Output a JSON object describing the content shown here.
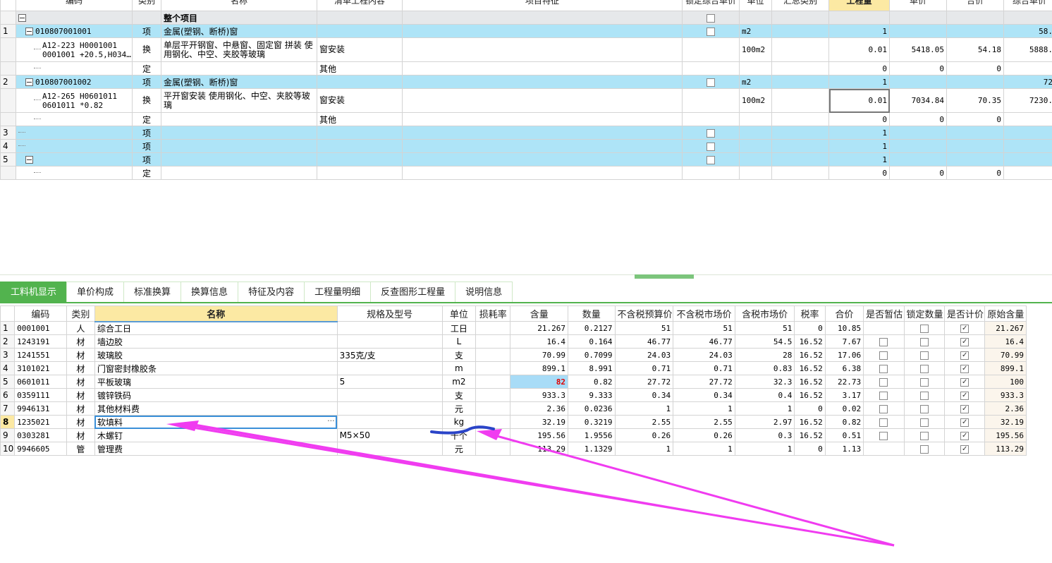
{
  "top_headers": [
    "编码",
    "类别",
    "名称",
    "清单工程内容",
    "项目特征",
    "锁定综合单价",
    "单位",
    "汇总类别",
    "工程量",
    "单价",
    "合价",
    "综合单价"
  ],
  "top_rows": [
    {
      "no": "",
      "code": "",
      "cat": "",
      "name": "整个项目",
      "content": "",
      "feature": "",
      "lock": true,
      "unit": "",
      "sum": "",
      "qty": "",
      "price": "",
      "total": "",
      "comp": "",
      "style": "root"
    },
    {
      "no": "1",
      "code": "010807001001",
      "cat": "项",
      "name": "金属(塑钢、断桥)窗",
      "content": "",
      "feature": "",
      "lock": true,
      "unit": "m2",
      "sum": "",
      "qty": "1",
      "price": "",
      "total": "",
      "comp": "58.",
      "style": "blue"
    },
    {
      "no": "",
      "code": "A12-223 H0001001 0001001 +20.5,H034…",
      "cat": "换",
      "name": "单层平开钢窗、中悬窗、固定窗  拼装  使用钢化、中空、夹胶等玻璃",
      "content": "窗安装",
      "feature": "",
      "lock": false,
      "unit": "100m2",
      "sum": "",
      "qty": "0.01",
      "price": "5418.05",
      "total": "54.18",
      "comp": "5888.",
      "style": "white"
    },
    {
      "no": "",
      "code": "",
      "cat": "定",
      "name": "",
      "content": "其他",
      "feature": "",
      "lock": false,
      "unit": "",
      "sum": "",
      "qty": "0",
      "price": "0",
      "total": "0",
      "comp": "",
      "style": "white"
    },
    {
      "no": "2",
      "code": "010807001002",
      "cat": "项",
      "name": "金属(塑钢、断桥)窗",
      "content": "",
      "feature": "",
      "lock": true,
      "unit": "m2",
      "sum": "",
      "qty": "1",
      "price": "",
      "total": "",
      "comp": "72",
      "style": "blue"
    },
    {
      "no": "",
      "code": "A12-265 H0601011 0601011 *0.82",
      "cat": "换",
      "name": "平开窗安装  使用钢化、中空、夹胶等玻璃",
      "content": "窗安装",
      "feature": "",
      "lock": false,
      "unit": "100m2",
      "sum": "",
      "qty": "0.01",
      "price": "7034.84",
      "total": "70.35",
      "comp": "7230.",
      "style": "white"
    },
    {
      "no": "",
      "code": "",
      "cat": "定",
      "name": "",
      "content": "其他",
      "feature": "",
      "lock": false,
      "unit": "",
      "sum": "",
      "qty": "0",
      "price": "0",
      "total": "0",
      "comp": "",
      "style": "white"
    },
    {
      "no": "3",
      "code": "",
      "cat": "项",
      "name": "",
      "content": "",
      "feature": "",
      "lock": true,
      "unit": "",
      "sum": "",
      "qty": "1",
      "price": "",
      "total": "",
      "comp": "",
      "style": "blue"
    },
    {
      "no": "4",
      "code": "",
      "cat": "项",
      "name": "",
      "content": "",
      "feature": "",
      "lock": true,
      "unit": "",
      "sum": "",
      "qty": "1",
      "price": "",
      "total": "",
      "comp": "",
      "style": "blue"
    },
    {
      "no": "5",
      "code": "",
      "cat": "项",
      "name": "",
      "content": "",
      "feature": "",
      "lock": true,
      "unit": "",
      "sum": "",
      "qty": "1",
      "price": "",
      "total": "",
      "comp": "",
      "style": "blue"
    },
    {
      "no": "",
      "code": "",
      "cat": "定",
      "name": "",
      "content": "",
      "feature": "",
      "lock": false,
      "unit": "",
      "sum": "",
      "qty": "0",
      "price": "0",
      "total": "0",
      "comp": "",
      "style": "white"
    }
  ],
  "tabs": [
    "工料机显示",
    "单价构成",
    "标准换算",
    "换算信息",
    "特征及内容",
    "工程量明细",
    "反查图形工程量",
    "说明信息"
  ],
  "bottom_headers": [
    "编码",
    "类别",
    "名称",
    "规格及型号",
    "单位",
    "损耗率",
    "含量",
    "数量",
    "不含税预算价",
    "不含税市场价",
    "含税市场价",
    "税率",
    "合价",
    "是否暂估",
    "锁定数量",
    "是否计价",
    "原始含量"
  ],
  "bottom_rows": [
    {
      "no": "1",
      "code": "0001001",
      "cat": "人",
      "name": "综合工日",
      "spec": "",
      "unit": "工日",
      "loss": "",
      "content": "21.267",
      "qty": "0.2127",
      "pre": "51",
      "mkt": "51",
      "taxmkt": "51",
      "rate": "0",
      "total": "10.85",
      "est": null,
      "lockq": false,
      "priced": true,
      "orig": "21.267"
    },
    {
      "no": "2",
      "code": "1243191",
      "cat": "材",
      "name": "墙边胶",
      "spec": "",
      "unit": "L",
      "loss": "",
      "content": "16.4",
      "qty": "0.164",
      "pre": "46.77",
      "mkt": "46.77",
      "taxmkt": "54.5",
      "rate": "16.52",
      "total": "7.67",
      "est": false,
      "lockq": false,
      "priced": true,
      "orig": "16.4"
    },
    {
      "no": "3",
      "code": "1241551",
      "cat": "材",
      "name": "玻璃胶",
      "spec": "335克/支",
      "unit": "支",
      "loss": "",
      "content": "70.99",
      "qty": "0.7099",
      "pre": "24.03",
      "mkt": "24.03",
      "taxmkt": "28",
      "rate": "16.52",
      "total": "17.06",
      "est": false,
      "lockq": false,
      "priced": true,
      "orig": "70.99"
    },
    {
      "no": "4",
      "code": "3101021",
      "cat": "材",
      "name": "门窗密封橡胶条",
      "spec": "",
      "unit": "m",
      "loss": "",
      "content": "899.1",
      "qty": "8.991",
      "pre": "0.71",
      "mkt": "0.71",
      "taxmkt": "0.83",
      "rate": "16.52",
      "total": "6.38",
      "est": false,
      "lockq": false,
      "priced": true,
      "orig": "899.1"
    },
    {
      "no": "5",
      "code": "0601011",
      "cat": "材",
      "name": "平板玻璃",
      "spec": "5",
      "unit": "m2",
      "loss": "",
      "content": "82",
      "qty": "0.82",
      "pre": "27.72",
      "mkt": "27.72",
      "taxmkt": "32.3",
      "rate": "16.52",
      "total": "22.73",
      "est": false,
      "lockq": false,
      "priced": true,
      "orig": "100"
    },
    {
      "no": "6",
      "code": "0359111",
      "cat": "材",
      "name": "镀锌铁码",
      "spec": "",
      "unit": "支",
      "loss": "",
      "content": "933.3",
      "qty": "9.333",
      "pre": "0.34",
      "mkt": "0.34",
      "taxmkt": "0.4",
      "rate": "16.52",
      "total": "3.17",
      "est": false,
      "lockq": false,
      "priced": true,
      "orig": "933.3"
    },
    {
      "no": "7",
      "code": "9946131",
      "cat": "材",
      "name": "其他材料费",
      "spec": "",
      "unit": "元",
      "loss": "",
      "content": "2.36",
      "qty": "0.0236",
      "pre": "1",
      "mkt": "1",
      "taxmkt": "1",
      "rate": "0",
      "total": "0.02",
      "est": false,
      "lockq": false,
      "priced": true,
      "orig": "2.36"
    },
    {
      "no": "8",
      "code": "1235021",
      "cat": "材",
      "name": "软填料",
      "spec": "",
      "unit": "kg",
      "loss": "",
      "content": "32.19",
      "qty": "0.3219",
      "pre": "2.55",
      "mkt": "2.55",
      "taxmkt": "2.97",
      "rate": "16.52",
      "total": "0.82",
      "est": false,
      "lockq": false,
      "priced": true,
      "orig": "32.19"
    },
    {
      "no": "9",
      "code": "0303281",
      "cat": "材",
      "name": "木螺钉",
      "spec": "M5×50",
      "unit": "十个",
      "loss": "",
      "content": "195.56",
      "qty": "1.9556",
      "pre": "0.26",
      "mkt": "0.26",
      "taxmkt": "0.3",
      "rate": "16.52",
      "total": "0.51",
      "est": false,
      "lockq": false,
      "priced": true,
      "orig": "195.56"
    },
    {
      "no": "10",
      "code": "9946605",
      "cat": "管",
      "name": "管理费",
      "spec": "",
      "unit": "元",
      "loss": "",
      "content": "113.29",
      "qty": "1.1329",
      "pre": "1",
      "mkt": "1",
      "taxmkt": "1",
      "rate": "0",
      "total": "1.13",
      "est": null,
      "lockq": false,
      "priced": true,
      "orig": "113.29"
    }
  ],
  "colors": {
    "tab_active": "#52b34e",
    "row_blue": "#aee4f7",
    "header_selected": "#fce9a3",
    "annotation_arrow": "#f03cf0",
    "annotation_mark": "#2a44c8"
  },
  "more_icon": "ellipsis-icon"
}
